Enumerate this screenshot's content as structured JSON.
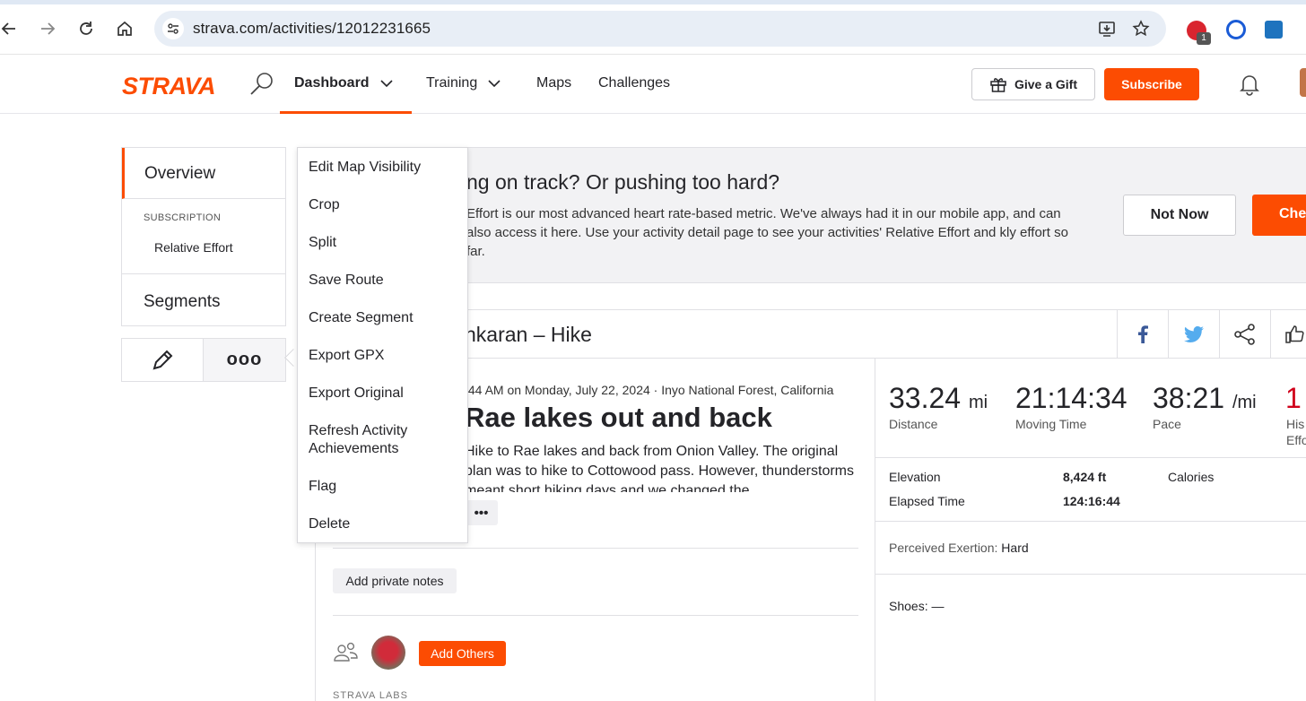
{
  "browser": {
    "url": "strava.com/activities/12012231665",
    "extension_badge": "1"
  },
  "nav": {
    "logo": "STRAVA",
    "items": [
      {
        "label": "Dashboard"
      },
      {
        "label": "Training"
      },
      {
        "label": "Maps"
      },
      {
        "label": "Challenges"
      }
    ],
    "gift_label": "Give a Gift",
    "subscribe_label": "Subscribe"
  },
  "sidebar": {
    "overview": "Overview",
    "subscription_heading": "SUBSCRIPTION",
    "relative_effort": "Relative Effort",
    "segments": "Segments",
    "more_label": "ooo"
  },
  "banner": {
    "heading": "ng on track? Or pushing too hard?",
    "body": "Effort is our most advanced heart rate-based metric. We've always had it in our mobile app, and can also access it here. Use your activity detail page to see your activities' Relative Effort and kly effort so far.",
    "not_now": "Not Now",
    "check": "Che"
  },
  "activity": {
    "title_bar": "nkaran – Hike",
    "meta": ":44 AM on Monday, July 22, 2024 · Inyo National Forest, California",
    "name": "Rae lakes out and back",
    "description": "Hike to Rae lakes and back from Onion Valley. The original plan was to hike to Cottowood pass. However, thunderstorms meant short hiking days and we changed the",
    "more_dots": "•••",
    "private_notes": "Add private notes",
    "add_others": "Add Others",
    "labs": "STRAVA LABS"
  },
  "stats": {
    "distance": {
      "value": "33.24",
      "unit": "mi",
      "label": "Distance"
    },
    "moving_time": {
      "value": "21:14:34",
      "label": "Moving Time"
    },
    "pace": {
      "value": "38:21",
      "unit": "/mi",
      "label": "Pace"
    },
    "partial": {
      "value": "1",
      "label1": "His",
      "label2": "Effo"
    },
    "elevation_label": "Elevation",
    "elevation_value": "8,424 ft",
    "calories_label": "Calories",
    "elapsed_label": "Elapsed Time",
    "elapsed_value": "124:16:44",
    "exertion_label": "Perceived Exertion:",
    "exertion_value": "Hard",
    "shoes": "Shoes: —"
  },
  "menu": {
    "items": [
      "Edit Map Visibility",
      "Crop",
      "Split",
      "Save Route",
      "Create Segment",
      "Export GPX",
      "Export Original",
      "Refresh Activity Achievements",
      "Flag",
      "Delete"
    ]
  },
  "colors": {
    "brand": "#fc4c02",
    "twitter": "#55acee",
    "facebook": "#3b5998"
  }
}
